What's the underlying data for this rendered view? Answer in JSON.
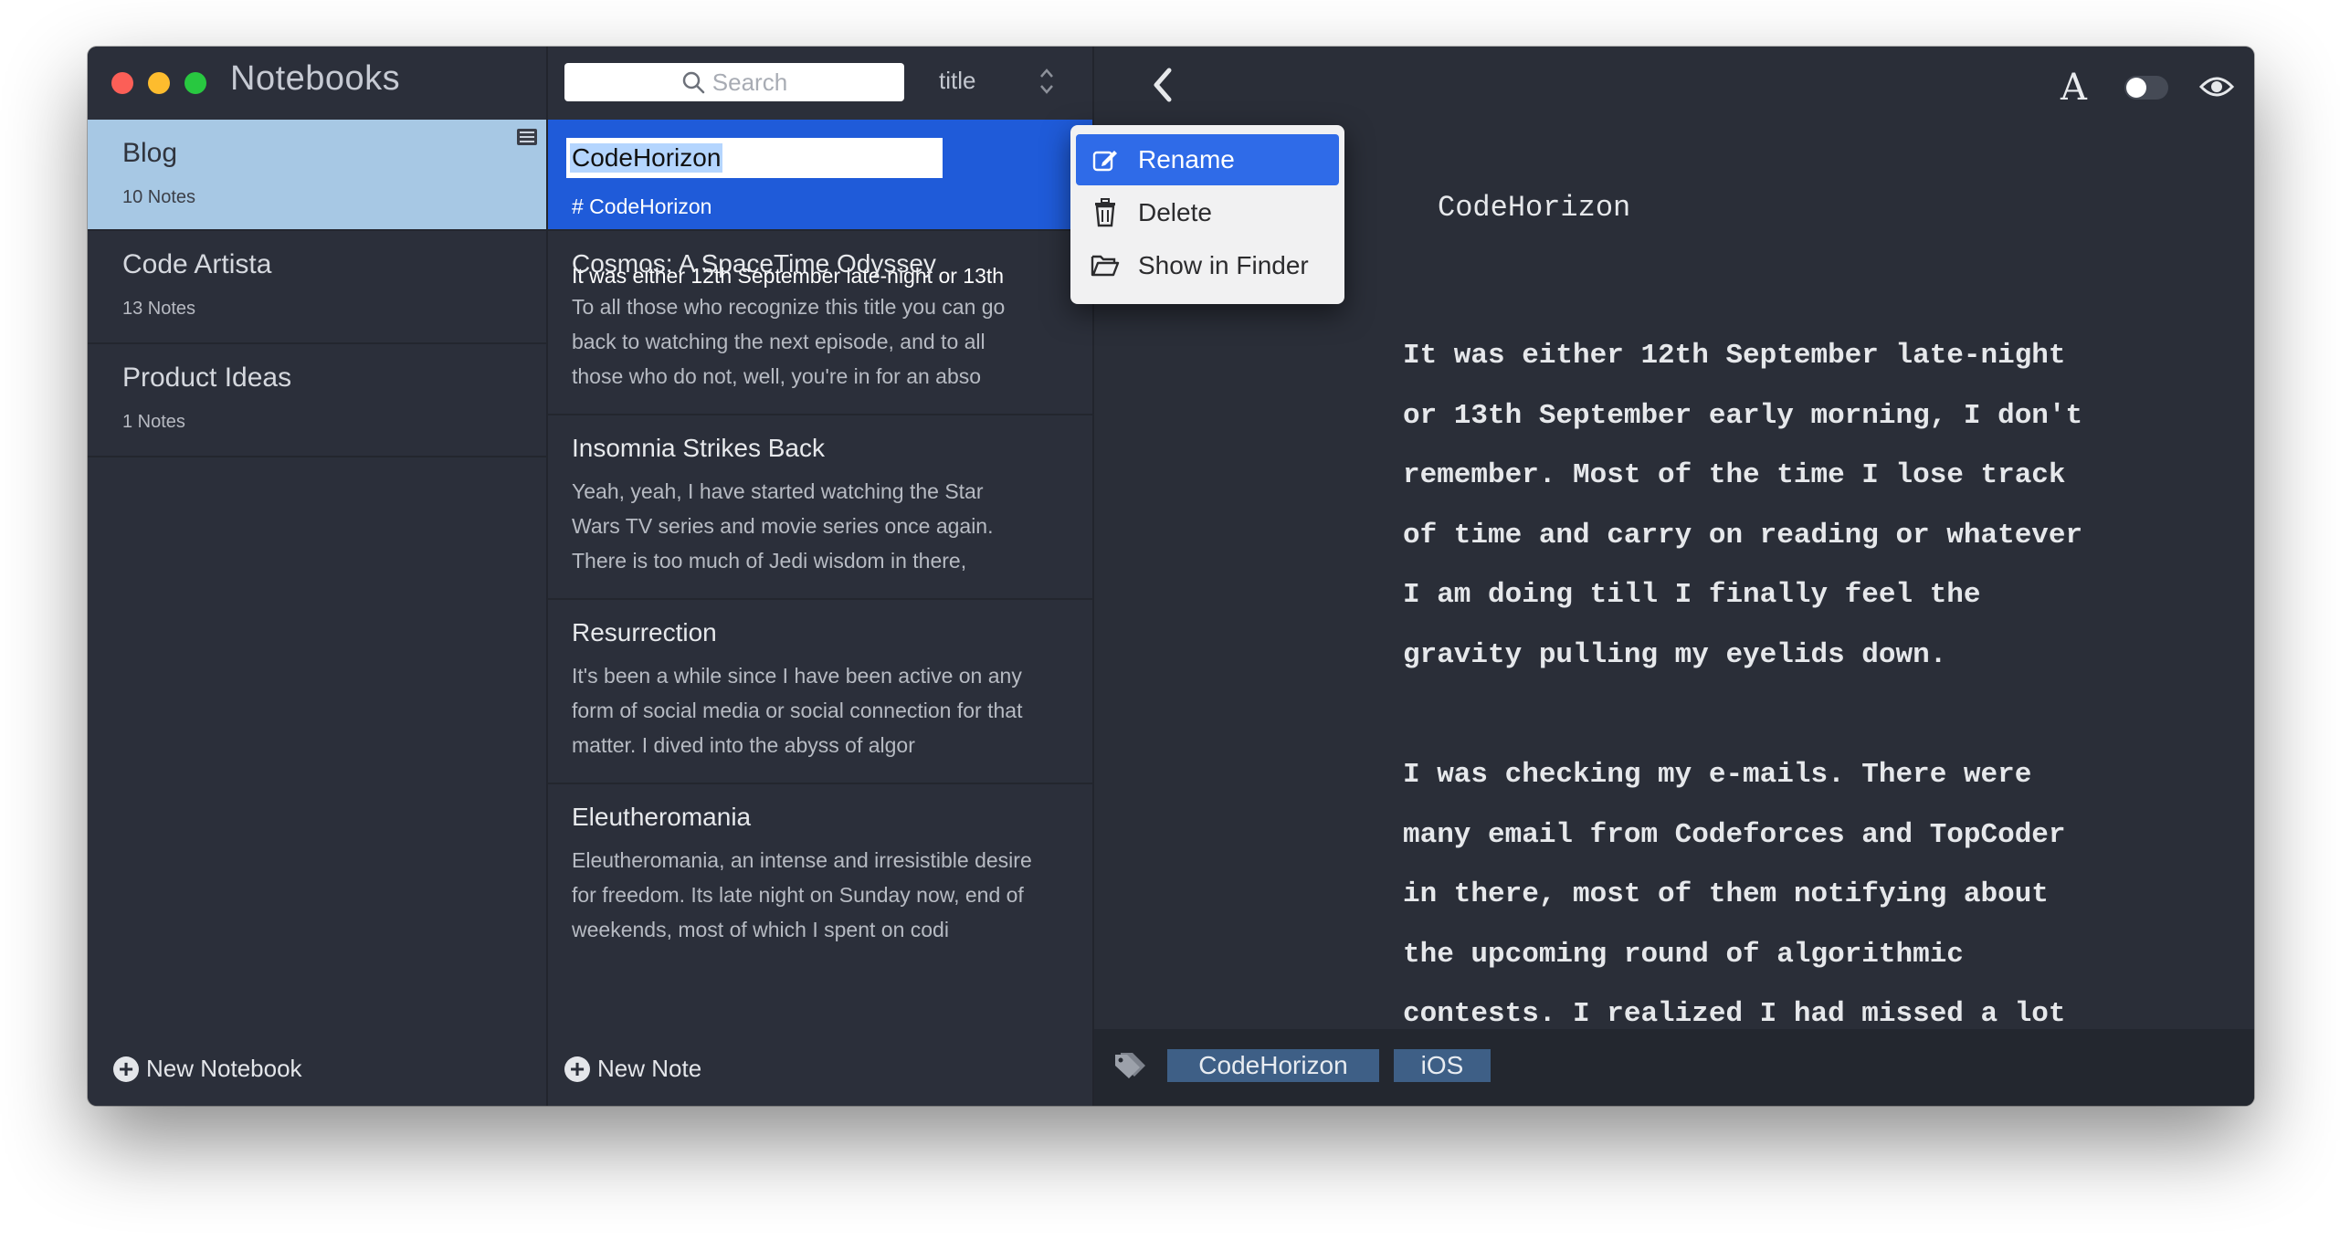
{
  "sidebar": {
    "title": "Notebooks",
    "notebooks": [
      {
        "name": "Blog",
        "count": "10 Notes"
      },
      {
        "name": "Code Artista",
        "count": "13 Notes"
      },
      {
        "name": "Product Ideas",
        "count": "1 Notes"
      }
    ],
    "new_notebook_label": "New Notebook"
  },
  "notelist": {
    "search_placeholder": "Search",
    "sort_label": "title",
    "active_note": {
      "title_input": "CodeHorizon",
      "tag_line": "# CodeHorizon",
      "preview": "It was either 12th September late-night or 13th"
    },
    "notes": [
      {
        "title": "Cosmos: A SpaceTime Odyssey",
        "preview": [
          "To all those who recognize this title you can go",
          "back to watching the next episode, and to all",
          "those who do not, well, you're in for an abso"
        ]
      },
      {
        "title": "Insomnia Strikes Back",
        "preview": [
          "Yeah, yeah, I have started watching the Star",
          "Wars TV series and movie series once again.",
          "There is too much of Jedi wisdom in there,"
        ]
      },
      {
        "title": "Resurrection",
        "preview": [
          "It's been a while since I have been active on any",
          "form of social media or social connection for that",
          "matter. I dived into the abyss of algor"
        ]
      },
      {
        "title": "Eleutheromania",
        "preview": [
          "Eleutheromania, an intense and irresistible desire",
          "for freedom. Its late night on Sunday now, end of",
          "weekends, most of which I spent on codi"
        ]
      }
    ],
    "new_note_label": "New Note"
  },
  "context_menu": {
    "items": [
      {
        "label": "Rename",
        "icon": "edit-icon"
      },
      {
        "label": "Delete",
        "icon": "trash-icon"
      },
      {
        "label": "Show in Finder",
        "icon": "folder-icon"
      }
    ]
  },
  "editor": {
    "toolbar": {
      "font_glyph": "A"
    },
    "heading": "CodeHorizon",
    "paragraphs": [
      [
        "It was either 12th September late-night",
        "or 13th September early morning, I don't",
        "remember. Most of the time I lose track",
        "of time and carry on reading or whatever",
        "I am doing till I finally feel the",
        "gravity pulling my eyelids down."
      ],
      [
        "I was checking my e-mails. There were",
        "many email from Codeforces and TopCoder",
        "in there, most of them notifying about",
        "the upcoming round of algorithmic",
        "contests. I realized I had missed a lot"
      ]
    ],
    "tags": [
      "CodeHorizon",
      "iOS"
    ]
  },
  "colors": {
    "window_bg": "#2a2e38",
    "sidebar_active": "#a7c8e4",
    "note_active": "#1f5bd9",
    "menu_highlight": "#2f6be8",
    "tag_chip": "#3e5f86"
  }
}
